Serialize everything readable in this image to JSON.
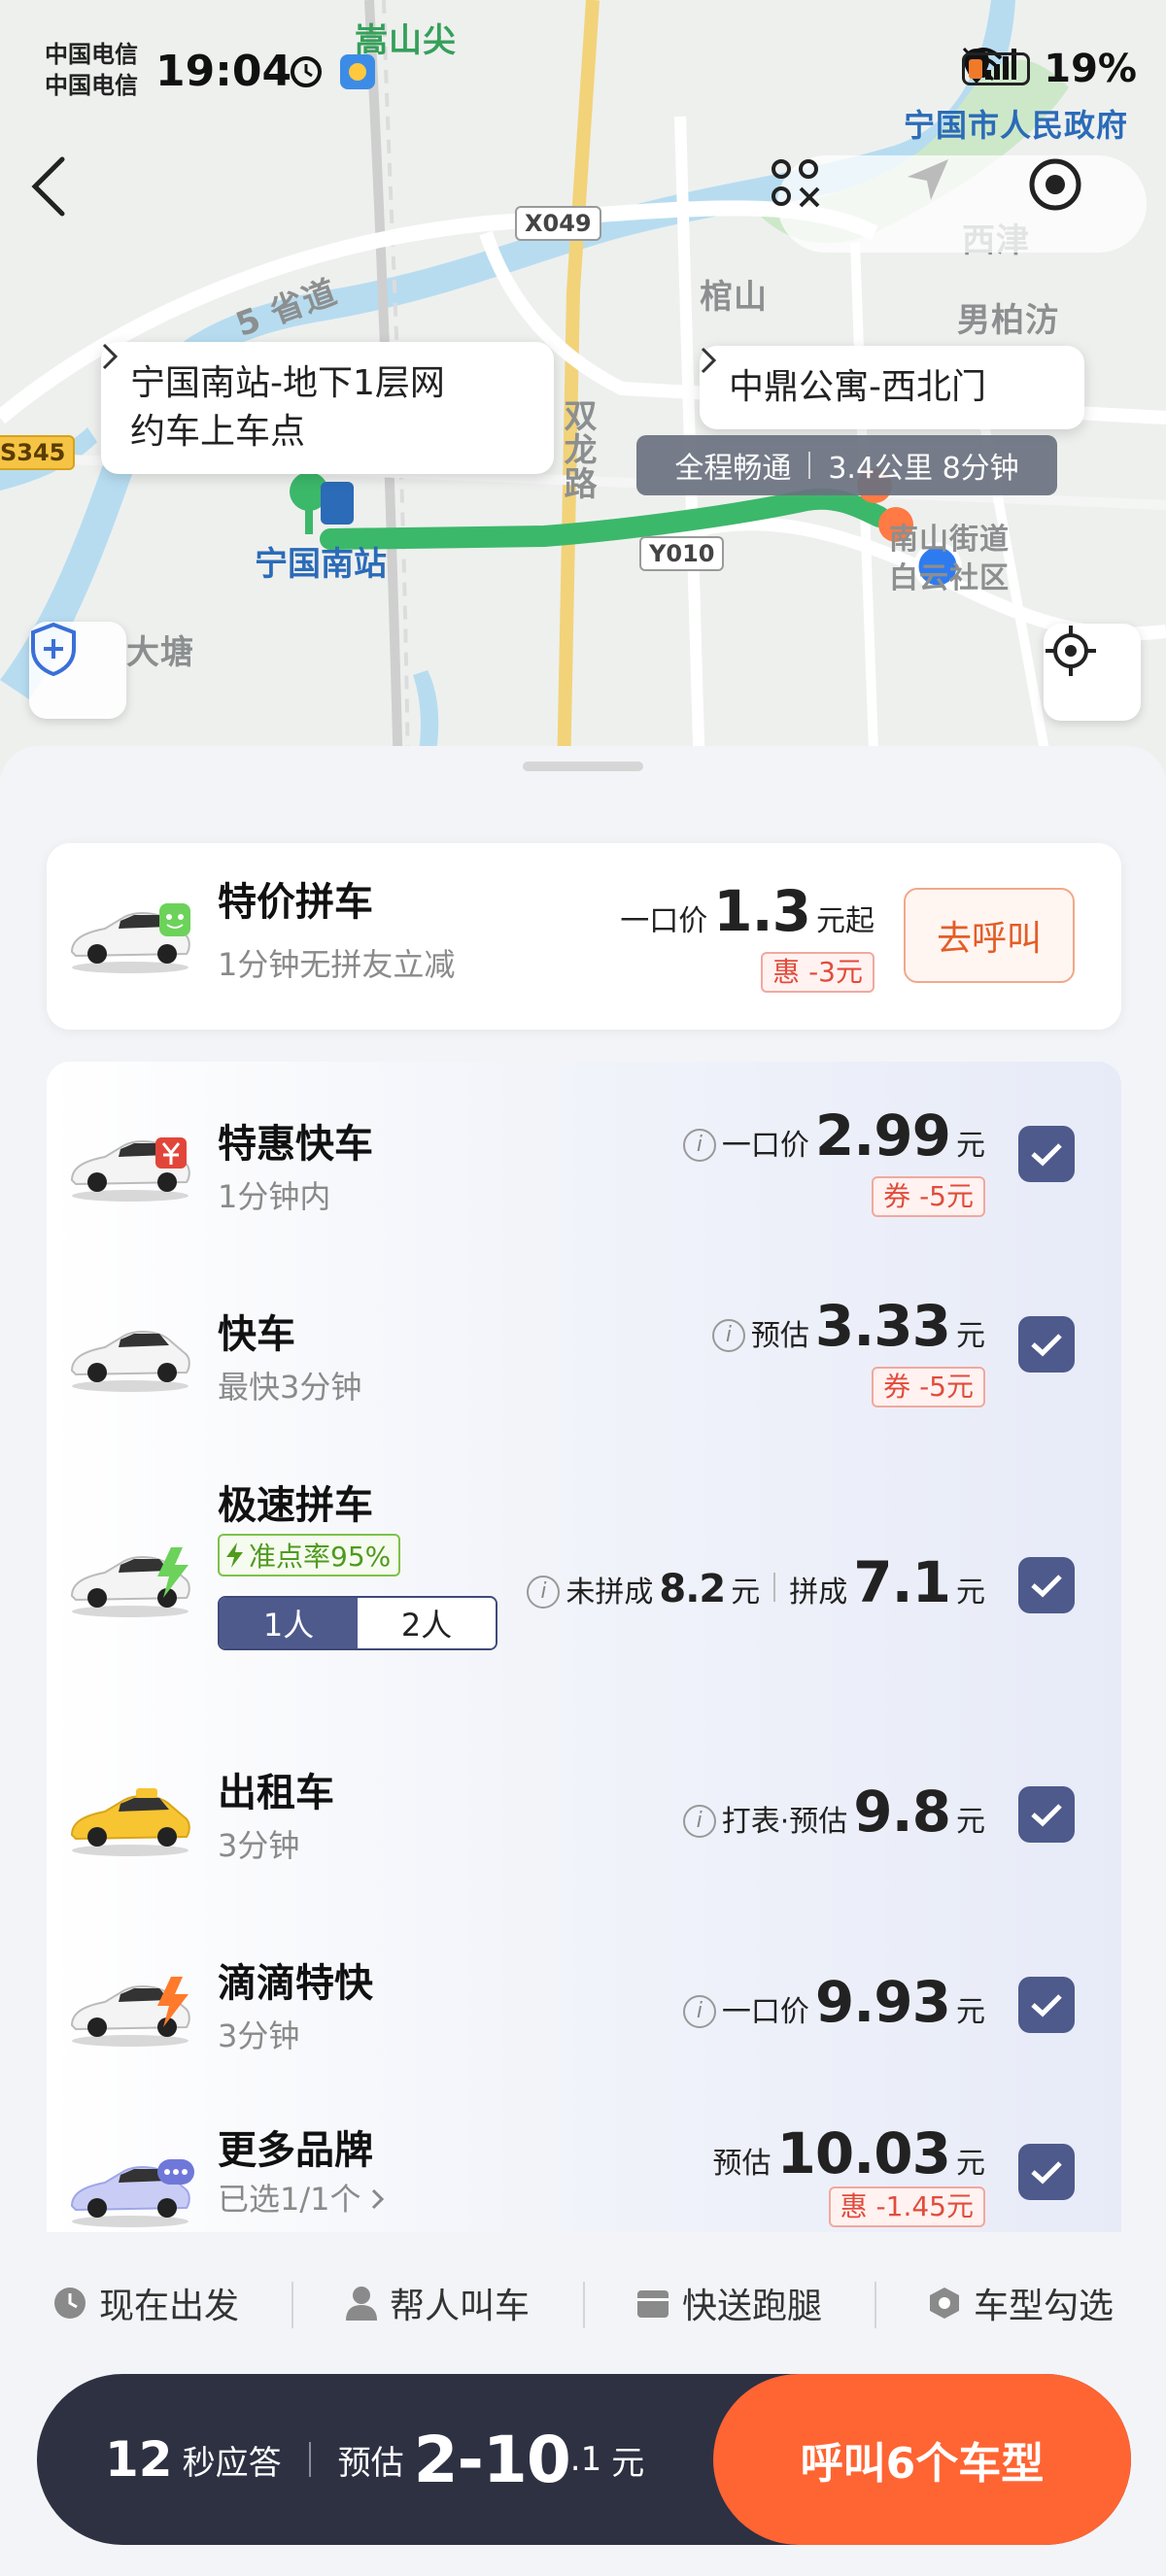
{
  "status_bar": {
    "carrier_1": "中国电信",
    "carrier_2": "中国电信",
    "time": "19:04",
    "battery": "19%"
  },
  "map": {
    "labels": {
      "songshanjian": "嵩山尖",
      "gov": "宁国市人民政府",
      "xijin": "西津",
      "guanshan": "棺山",
      "nanbaifang": "男柏汸",
      "provincial_road": "5 省道",
      "shuanglong_road": "双龙路",
      "datang": "大塘",
      "nanshan": "南山街道",
      "community": "白云社区"
    },
    "road_badges": {
      "x049": "X049",
      "s345": "S345",
      "y010": "Y010"
    },
    "pickup_bubble_line1": "宁国南站-地下1层网",
    "pickup_bubble_line2": "约车上车点",
    "dest_bubble": "中鼎公寓-西北门",
    "route_status": "全程畅通",
    "route_info": "3.4公里 8分钟",
    "start_name": "宁国南站"
  },
  "featured": {
    "title": "特价拼车",
    "subtitle": "1分钟无拼友立减",
    "price_label": "一口价",
    "price": "1.3",
    "price_unit": "元起",
    "discount": "惠 -3元",
    "call_label": "去呼叫"
  },
  "rides": [
    {
      "title": "特惠快车",
      "subtitle": "1分钟内",
      "price_label": "一口价",
      "price": "2.99",
      "unit": "元",
      "coupon": "券 -5元",
      "checked": true
    },
    {
      "title": "快车",
      "subtitle": "最快3分钟",
      "price_label": "预估",
      "price": "3.33",
      "unit": "元",
      "coupon": "券 -5元",
      "checked": true
    },
    {
      "title": "极速拼车",
      "badge": "准点率95%",
      "seg_1": "1人",
      "seg_2": "2人",
      "unmatched_label": "未拼成",
      "unmatched_price": "8.2",
      "unit": "元",
      "matched_label": "拼成",
      "matched_price": "7.1",
      "checked": true
    },
    {
      "title": "出租车",
      "subtitle": "3分钟",
      "price_label": "打表·预估",
      "price": "9.8",
      "unit": "元",
      "checked": true
    },
    {
      "title": "滴滴特快",
      "subtitle": "3分钟",
      "price_label": "一口价",
      "price": "9.93",
      "unit": "元",
      "checked": true
    },
    {
      "title": "更多品牌",
      "subtitle": "已选1/1个",
      "price_label": "预估",
      "price": "10.03",
      "unit": "元",
      "coupon": "惠 -1.45元",
      "checked": true
    }
  ],
  "options": {
    "depart": "现在出发",
    "for_others": "帮人叫车",
    "delivery": "快送跑腿",
    "car_select": "车型勾选"
  },
  "bottom": {
    "response_num": "12",
    "response_label": "秒应答",
    "estimate_label": "预估",
    "range_main": "2-10",
    "range_decimal": ".1",
    "range_unit": "元",
    "call_button": "呼叫6个车型"
  },
  "colors": {
    "accent_orange": "#ff6433",
    "route_green": "#3cb86a",
    "check_blue": "#4e5a8c",
    "coupon_red": "#e24b3b"
  }
}
